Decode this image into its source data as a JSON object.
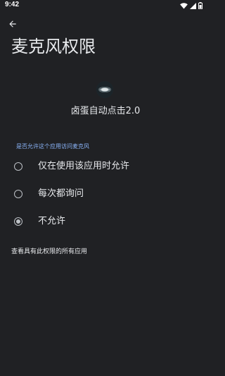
{
  "status_bar": {
    "time": "9:42"
  },
  "header": {
    "back_icon": "arrow-back-icon",
    "title": "麦克风权限"
  },
  "app": {
    "icon": "app-icon",
    "name": "卤蛋自动点击2.0"
  },
  "permission": {
    "section_header": "是否允许这个应用访问麦克风",
    "options": [
      {
        "label": "仅在使用该应用时允许",
        "selected": false
      },
      {
        "label": "每次都询问",
        "selected": false
      },
      {
        "label": "不允许",
        "selected": true
      }
    ]
  },
  "footer": {
    "link": "查看具有此权限的所有应用"
  },
  "colors": {
    "background": "#202124",
    "text": "#e8eaed",
    "accent": "#8ab4f8",
    "radio": "#bdc1c6"
  }
}
